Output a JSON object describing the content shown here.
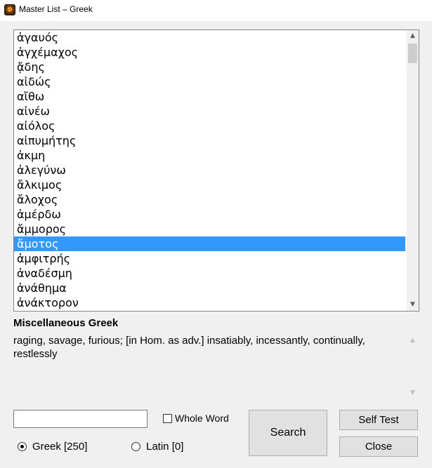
{
  "window": {
    "title": "Master List – Greek"
  },
  "list": {
    "items": [
      "ἀγαυός",
      "ἀγχέμαχος",
      "ᾄδης",
      "αἰδώς",
      "αἴθω",
      "αἰνέω",
      "αἰόλος",
      "αἰπυμήτης",
      "ἀκμη",
      "ἀλεγύνω",
      "ἄλκιμος",
      "ἄλοχος",
      "ἀμέρδω",
      "ἄμμορος",
      "ἄμοτος",
      "ἀμφιτρής",
      "ἀναδέσμη",
      "ἀνάθημα",
      "ἀνάκτορον"
    ],
    "selected_index": 14
  },
  "detail": {
    "category": "Miscellaneous Greek",
    "definition": "raging, savage, furious; [in Hom. as adv.] insatiably, incessantly, continually, restlessly"
  },
  "search": {
    "value": "",
    "placeholder": ""
  },
  "options": {
    "whole_word_label": "Whole Word",
    "whole_word_checked": false,
    "greek_label": "Greek  [250]",
    "greek_selected": true,
    "latin_label": "Latin  [0]",
    "latin_selected": false
  },
  "buttons": {
    "search": "Search",
    "self_test": "Self Test",
    "close": "Close"
  },
  "icons": {
    "app": "app-icon",
    "scroll_up": "scroll-up-arrow-icon",
    "scroll_down": "scroll-down-arrow-icon"
  },
  "colors": {
    "selection": "#3399ff",
    "window_bg": "#f0f0f0"
  }
}
